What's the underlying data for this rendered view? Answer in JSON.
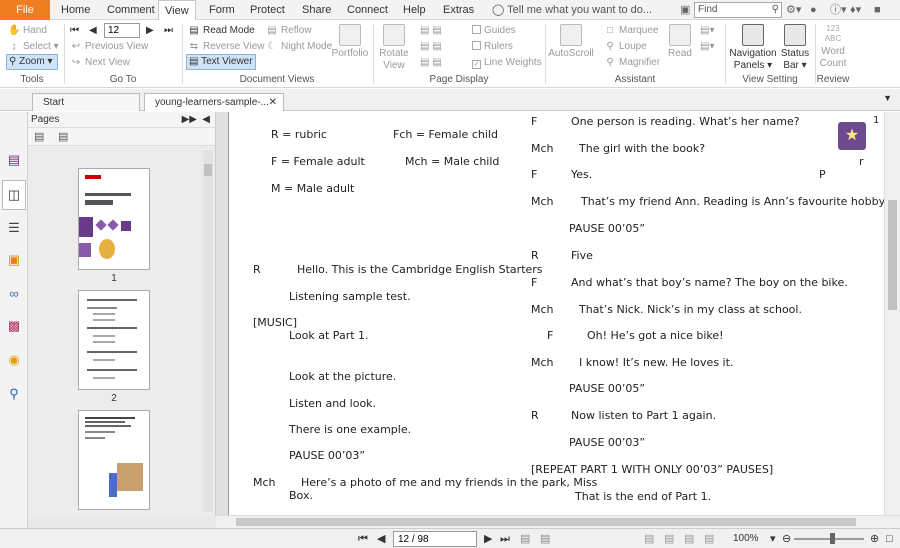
{
  "menu": {
    "file": "File",
    "tabs": [
      "Home",
      "Comment",
      "View",
      "Form",
      "Protect",
      "Share",
      "Connect",
      "Help",
      "Extras"
    ],
    "active_tab": "View",
    "tell_me": "Tell me what you want to do...",
    "find_placeholder": "Find"
  },
  "ribbon": {
    "tools": {
      "hand": "Hand",
      "select": "Select",
      "zoom": "Zoom",
      "label": "Tools"
    },
    "goto": {
      "page_value": "12",
      "previous_view": "Previous View",
      "next_view": "Next View",
      "label": "Go To"
    },
    "document_views": {
      "read_mode": "Read Mode",
      "reverse_view": "Reverse View",
      "text_viewer": "Text Viewer",
      "reflow": "Reflow",
      "night_mode": "Night Mode",
      "portfolio": "Portfolio",
      "label": "Document Views"
    },
    "page_display": {
      "rotate_view": "Rotate View",
      "guides": "Guides",
      "rulers": "Rulers",
      "line_weights": "Line Weights",
      "label": "Page Display"
    },
    "assistant": {
      "autoscroll": "AutoScroll",
      "marquee": "Marquee",
      "loupe": "Loupe",
      "magnifier": "Magnifier",
      "label": "Assistant"
    },
    "read": "Read",
    "view_setting": {
      "navigation_panels": "Navigation Panels",
      "status_bar": "Status Bar",
      "label": "View Setting"
    },
    "review": {
      "word_count": "Word Count",
      "word_count_icon": "123 ABC",
      "label": "Review"
    }
  },
  "tabs": {
    "start": "Start",
    "document": "young-learners-sample-..."
  },
  "pages_panel": {
    "title": "Pages",
    "thumbnails": [
      {
        "num": "1"
      },
      {
        "num": "2"
      }
    ]
  },
  "document": {
    "page_marker": "1",
    "left_column": [
      "R = rubric",
      "Fch = Female child",
      "F = Female adult",
      "Mch = Male child",
      "M = Male adult",
      "R",
      "Hello. This is the Cambridge English Starters",
      "Listening sample test.",
      "[MUSIC]",
      "Look at Part 1.",
      "Look at the picture.",
      "Listen and look.",
      "There is one example.",
      "PAUSE 00’03”",
      "Mch",
      "Here’s a photo of me and my friends in the park, Miss",
      "Box."
    ],
    "right_column": [
      "F",
      "One person is reading. What’s her name?",
      "Mch",
      "The girl with the book?",
      "F",
      "Yes.",
      "P",
      "Mch",
      "That’s my friend Ann. Reading is Ann’s favourite hobby.",
      "PAUSE 00’05”",
      "R",
      "Five",
      "F",
      "And what’s that boy’s name? The boy on the bike.",
      "Mch",
      "That’s Nick. Nick’s in my class at school.",
      "F",
      "Oh! He’s got a nice bike!",
      "Mch",
      "I know! It’s new. He loves it.",
      "PAUSE 00’05”",
      "R",
      "Now listen to Part 1 again.",
      "PAUSE 00’03”",
      "[REPEAT PART 1 WITH ONLY 00’03” PAUSES]",
      "That is the end of Part 1.",
      "r"
    ]
  },
  "status": {
    "page": "12 / 98",
    "zoom": "100%"
  }
}
